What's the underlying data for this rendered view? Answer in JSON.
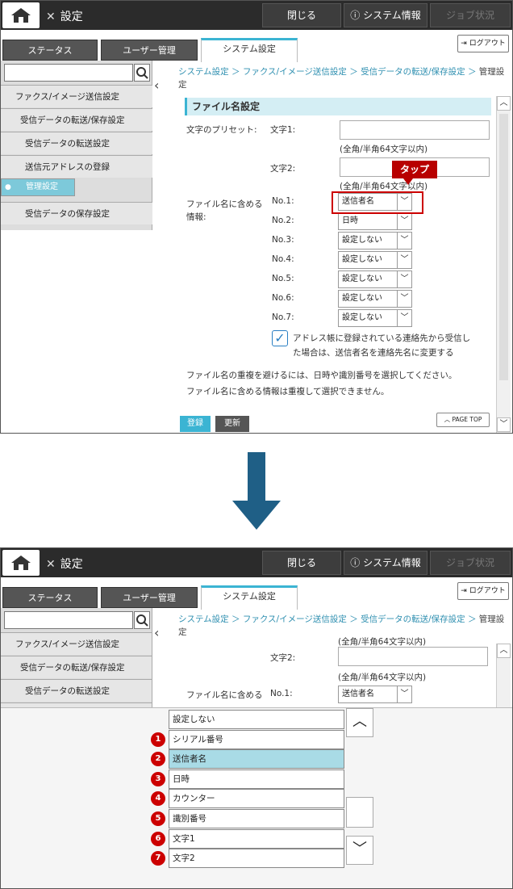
{
  "app": {
    "title": "設定",
    "close": "閉じる",
    "sysinfo": "システム情報",
    "job": "ジョブ状況",
    "logout": "ログアウト"
  },
  "tabs": [
    "ステータス",
    "ユーザー管理",
    "システム設定"
  ],
  "sidebar": [
    "ファクス/イメージ送信設定",
    "受信データの転送/保存設定",
    "受信データの転送設定",
    "送信元アドレスの登録",
    "管理設定",
    "受信データの保存設定"
  ],
  "breadcrumb": {
    "a": "システム設定 ＞",
    "b": "ファクス/イメージ送信設定 ＞",
    "c": "受信データの転送/保存設定 ＞",
    "d": "管理設定"
  },
  "section": "ファイル名設定",
  "preset": {
    "label": "文字のプリセット:",
    "t1": "文字1:",
    "t2": "文字2:",
    "hint": "(全角/半角64文字以内)"
  },
  "fileinfo": {
    "label": "ファイル名に含める",
    "label2": "情報:",
    "rows": [
      {
        "no": "No.1:",
        "v": "送信者名"
      },
      {
        "no": "No.2:",
        "v": "日時"
      },
      {
        "no": "No.3:",
        "v": "設定しない"
      },
      {
        "no": "No.4:",
        "v": "設定しない"
      },
      {
        "no": "No.5:",
        "v": "設定しない"
      },
      {
        "no": "No.6:",
        "v": "設定しない"
      },
      {
        "no": "No.7:",
        "v": "設定しない"
      }
    ]
  },
  "checkbox": {
    "l1": "アドレス帳に登録されている連絡先から受信し",
    "l2": "た場合は、送信者名を連絡先名に変更する"
  },
  "note1": "ファイル名の重複を避けるには、日時や識別番号を選択してください。",
  "note2": "ファイル名に含める情報は重複して選択できません。",
  "buttons": {
    "save": "登録",
    "update": "更新",
    "pagetop": "PAGE TOP"
  },
  "tap": "タップ",
  "options": [
    {
      "n": "",
      "v": "設定しない"
    },
    {
      "n": "1",
      "v": "シリアル番号"
    },
    {
      "n": "2",
      "v": "送信者名"
    },
    {
      "n": "3",
      "v": "日時"
    },
    {
      "n": "4",
      "v": "カウンター"
    },
    {
      "n": "5",
      "v": "識別番号"
    },
    {
      "n": "6",
      "v": "文字1"
    },
    {
      "n": "7",
      "v": "文字2"
    }
  ],
  "colors": {
    "accent": "#3bb4d3",
    "red": "#c00000",
    "arrow": "#1f5f86"
  }
}
